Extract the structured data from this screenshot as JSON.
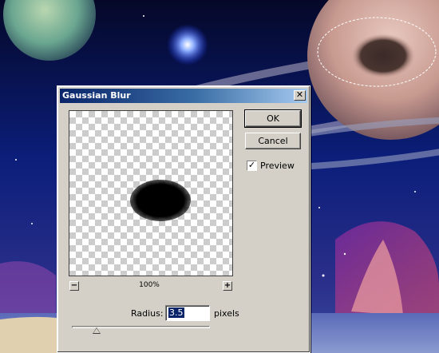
{
  "dialog": {
    "title": "Gaussian Blur",
    "close_glyph": "✕",
    "ok_label": "OK",
    "cancel_label": "Cancel",
    "preview": {
      "label": "Preview",
      "checked": true,
      "check_glyph": "✓"
    },
    "zoom": {
      "minus": "−",
      "plus": "+",
      "level": "100%"
    },
    "radius": {
      "label": "Radius:",
      "value": "3.5",
      "unit": "pixels",
      "slider_fraction": 0.18
    }
  },
  "colors": {
    "title_gradient_start": "#0a246a",
    "title_gradient_end": "#a6caf0",
    "dialog_face": "#d4d0c8"
  },
  "icons": {
    "close": "close-icon",
    "checkbox": "check-icon"
  }
}
